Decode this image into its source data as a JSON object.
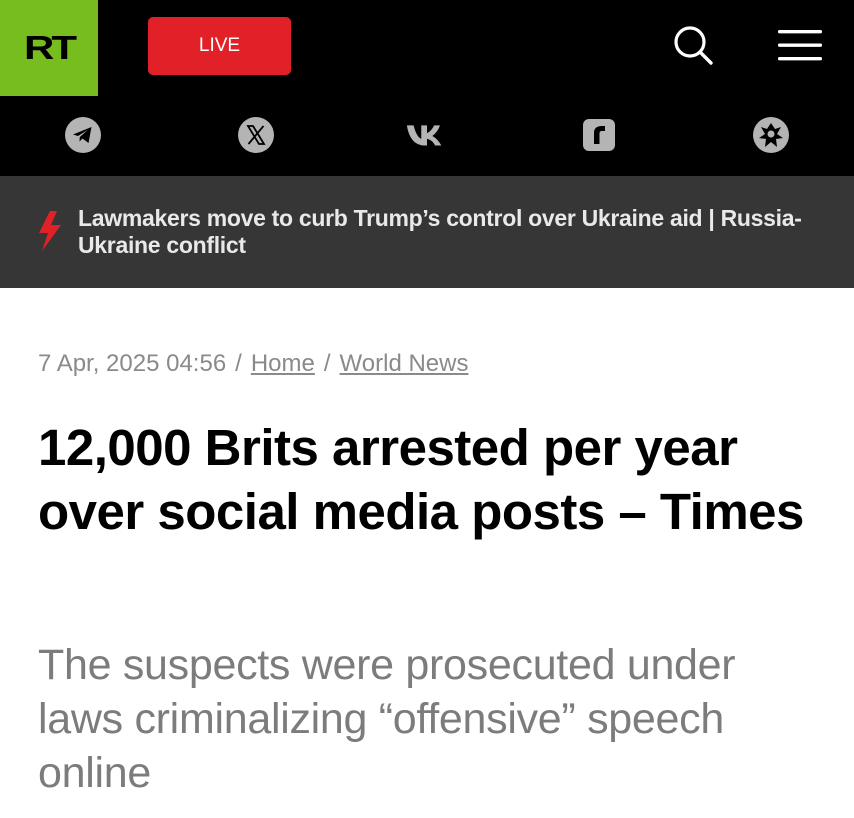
{
  "header": {
    "logo_text": "RT",
    "live_label": "LIVE",
    "icons": {
      "search": "search-icon",
      "menu": "hamburger-menu-icon"
    },
    "social_icons": [
      "telegram-icon",
      "x-icon",
      "vk-icon",
      "rumble-icon",
      "odysee-icon"
    ],
    "colors": {
      "background": "#000000",
      "logo_green": "#77bd1e",
      "live_red": "#e12127"
    }
  },
  "ticker": {
    "icon": "lightning-bolt-icon",
    "text": "Lawmakers move to curb Trump’s control over Ukraine aid | Russia-Ukraine conflict",
    "colors": {
      "background": "#363636",
      "bolt": "#e12127"
    }
  },
  "article": {
    "date": "7 Apr, 2025 04:56",
    "breadcrumb_separator": "/",
    "breadcrumbs": [
      "Home",
      "World News"
    ],
    "headline": "12,000 Brits arrested per year over social media posts – Times",
    "summary": "The suspects were prosecuted under laws criminalizing “offensive” speech online"
  }
}
